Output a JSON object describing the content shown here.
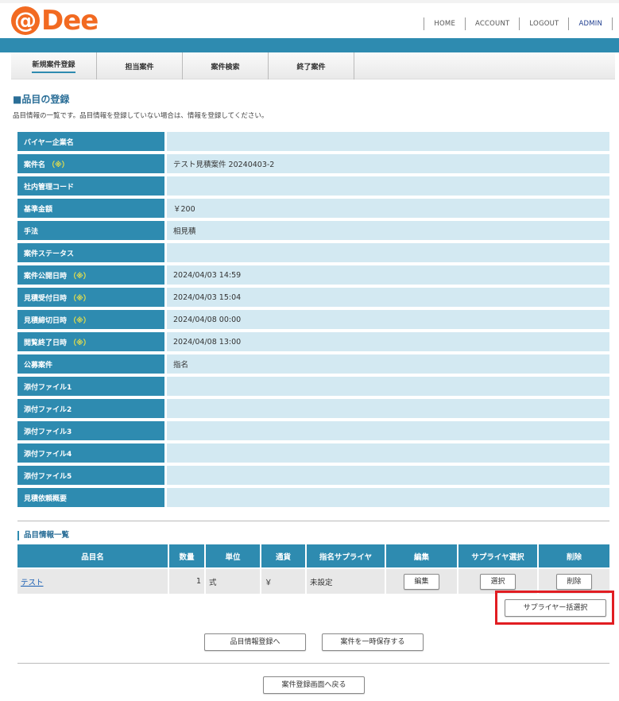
{
  "header": {
    "logo_at": "@",
    "logo_word": "Dee",
    "nav": [
      "HOME",
      "ACCOUNT",
      "LOGOUT",
      "ADMIN"
    ]
  },
  "tabs": [
    "新規案件登録",
    "担当案件",
    "案件検索",
    "終了案件"
  ],
  "page": {
    "title": "■品目の登録",
    "description": "品目情報の一覧です。品目情報を登録していない場合は、情報を登録してください。"
  },
  "info_rows": [
    {
      "label": "バイヤー企業名",
      "required": "",
      "value": ""
    },
    {
      "label": "案件名",
      "required": "（※）",
      "value": "テスト見積案件 20240403-2"
    },
    {
      "label": "社内管理コード",
      "required": "",
      "value": ""
    },
    {
      "label": "基準金額",
      "required": "",
      "value": "￥200"
    },
    {
      "label": "手法",
      "required": "",
      "value": "相見積"
    },
    {
      "label": "案件ステータス",
      "required": "",
      "value": ""
    },
    {
      "label": "案件公開日時",
      "required": "（※）",
      "value": "2024/04/03 14:59"
    },
    {
      "label": "見積受付日時",
      "required": "（※）",
      "value": "2024/04/03 15:04"
    },
    {
      "label": "見積締切日時",
      "required": "（※）",
      "value": "2024/04/08 00:00"
    },
    {
      "label": "閲覧終了日時",
      "required": "（※）",
      "value": "2024/04/08 13:00"
    },
    {
      "label": "公募案件",
      "required": "",
      "value": "指名"
    },
    {
      "label": "添付ファイル1",
      "required": "",
      "value": ""
    },
    {
      "label": "添付ファイル2",
      "required": "",
      "value": ""
    },
    {
      "label": "添付ファイル3",
      "required": "",
      "value": ""
    },
    {
      "label": "添付ファイル4",
      "required": "",
      "value": ""
    },
    {
      "label": "添付ファイル5",
      "required": "",
      "value": ""
    },
    {
      "label": "見積依頼概要",
      "required": "",
      "value": ""
    }
  ],
  "items_section": {
    "title": "品目情報一覧",
    "columns": [
      "品目名",
      "数量",
      "単位",
      "通貨",
      "指名サプライヤ",
      "編集",
      "サプライヤ選択",
      "削除"
    ],
    "rows": [
      {
        "name": "テスト",
        "qty": "1",
        "unit": "式",
        "currency": "￥",
        "supplier": "未設定",
        "edit": "編集",
        "select": "選択",
        "delete": "削除"
      }
    ]
  },
  "buttons": {
    "bulk_select": "サプライヤー括選択",
    "register_items": "品目情報登録へ",
    "save_temp": "案件を一時保存する",
    "back": "案件登録画面へ戻る"
  },
  "colors": {
    "brand": "#f26a21",
    "header_bar": "#2e8bb0",
    "value_cell": "#d3e9f2",
    "required_mark": "#e8e04a",
    "highlight": "#e11d22"
  }
}
